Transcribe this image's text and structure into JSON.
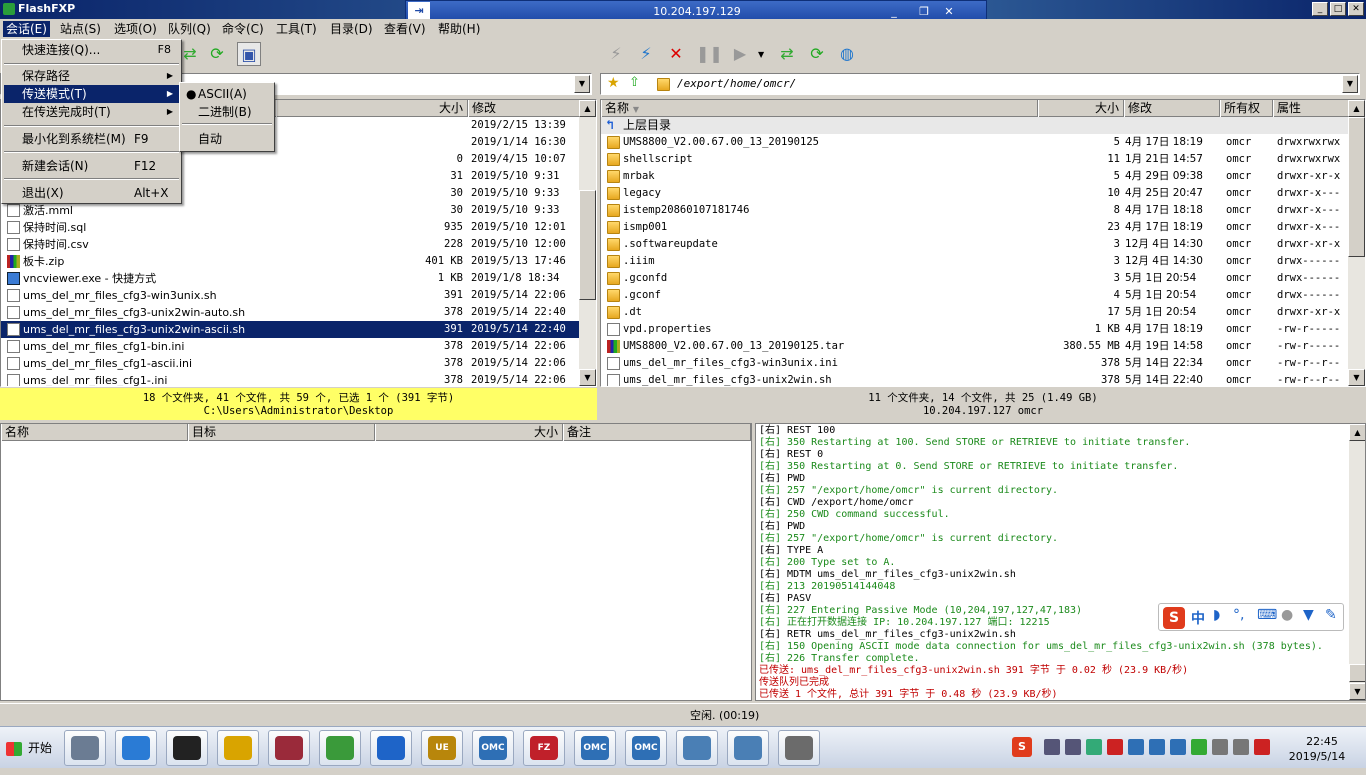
{
  "app": {
    "title": "FlashFXP"
  },
  "remote_session": {
    "title": "10.204.197.129"
  },
  "menubar": [
    "会话(E)",
    "站点(S)",
    "选项(O)",
    "队列(Q)",
    "命令(C)",
    "工具(T)",
    "目录(D)",
    "查看(V)",
    "帮助(H)"
  ],
  "session_menu": {
    "items": [
      {
        "label": "快速连接(Q)...",
        "shortcut": "F8"
      },
      {
        "label": "保存路径",
        "shortcut": ""
      },
      {
        "label": "传送模式(T)",
        "shortcut": ""
      },
      {
        "label": "在传送完成时(T)",
        "shortcut": ""
      },
      {
        "label": "最小化到系统栏(M)",
        "shortcut": "F9"
      },
      {
        "label": "新建会话(N)",
        "shortcut": "F12"
      },
      {
        "label": "退出(X)",
        "shortcut": "Alt+X"
      }
    ]
  },
  "transfer_submenu": [
    "ASCII(A)",
    "二进制(B)",
    "自动"
  ],
  "left_panel": {
    "path": "",
    "columns": {
      "size": "大小",
      "modified": "修改"
    },
    "rows": [
      {
        "name": "",
        "size": "",
        "date": "2019/2/15 13:39",
        "icon": "folder"
      },
      {
        "name": "",
        "size": "",
        "date": "2019/1/14 16:30",
        "icon": "folder"
      },
      {
        "name": "",
        "size": "0",
        "date": "2019/4/15 10:07",
        "icon": "file"
      },
      {
        "name": "",
        "size": "31",
        "date": "2019/5/10 9:31",
        "icon": "file"
      },
      {
        "name": "",
        "size": "30",
        "date": "2019/5/10 9:33",
        "icon": "file"
      },
      {
        "name": "激活.mml",
        "size": "30",
        "date": "2019/5/10 9:33",
        "icon": "file"
      },
      {
        "name": "保持时间.sql",
        "size": "935",
        "date": "2019/5/10 12:01",
        "icon": "file"
      },
      {
        "name": "保持时间.csv",
        "size": "228",
        "date": "2019/5/10 12:00",
        "icon": "file"
      },
      {
        "name": "板卡.zip",
        "size": "401 KB",
        "date": "2019/5/13 17:46",
        "icon": "zip"
      },
      {
        "name": "vncviewer.exe - 快捷方式",
        "size": "1 KB",
        "date": "2019/1/8 18:34",
        "icon": "app"
      },
      {
        "name": "ums_del_mr_files_cfg3-win3unix.sh",
        "size": "391",
        "date": "2019/5/14 22:06",
        "icon": "file"
      },
      {
        "name": "ums_del_mr_files_cfg3-unix2win-auto.sh",
        "size": "378",
        "date": "2019/5/14 22:40",
        "icon": "file"
      },
      {
        "name": "ums_del_mr_files_cfg3-unix2win-ascii.sh",
        "size": "391",
        "date": "2019/5/14 22:40",
        "icon": "file",
        "selected": true
      },
      {
        "name": "ums_del_mr_files_cfg1-bin.ini",
        "size": "378",
        "date": "2019/5/14 22:06",
        "icon": "file"
      },
      {
        "name": "ums_del_mr_files_cfg1-ascii.ini",
        "size": "378",
        "date": "2019/5/14 22:06",
        "icon": "file"
      },
      {
        "name": "ums_del_mr_files_cfg1-.ini",
        "size": "378",
        "date": "2019/5/14 22:06",
        "icon": "file"
      }
    ],
    "status_line1": "18 个文件夹, 41 个文件, 共 59 个, 已选 1 个 (391 字节)",
    "status_line2": "C:\\Users\\Administrator\\Desktop"
  },
  "right_panel": {
    "path": "/export/home/omcr/",
    "columns": {
      "name": "名称",
      "size": "大小",
      "modified": "修改",
      "owner": "所有权",
      "attr": "属性"
    },
    "parent_label": "上层目录",
    "rows": [
      {
        "name": "UMS8800_V2.00.67.00_13_20190125",
        "size": "5",
        "date": "4月 17日 18:19",
        "owner": "omcr",
        "attr": "drwxrwxrwx",
        "icon": "folder"
      },
      {
        "name": "shellscript",
        "size": "11",
        "date": "1月 21日 14:57",
        "owner": "omcr",
        "attr": "drwxrwxrwx",
        "icon": "folder"
      },
      {
        "name": "mrbak",
        "size": "5",
        "date": "4月 29日 09:38",
        "owner": "omcr",
        "attr": "drwxr-xr-x",
        "icon": "folder"
      },
      {
        "name": "legacy",
        "size": "10",
        "date": "4月 25日 20:47",
        "owner": "omcr",
        "attr": "drwxr-x---",
        "icon": "folder"
      },
      {
        "name": "istemp20860107181746",
        "size": "8",
        "date": "4月 17日 18:18",
        "owner": "omcr",
        "attr": "drwxr-x---",
        "icon": "folder"
      },
      {
        "name": "ismp001",
        "size": "23",
        "date": "4月 17日 18:19",
        "owner": "omcr",
        "attr": "drwxr-x---",
        "icon": "folder"
      },
      {
        "name": ".softwareupdate",
        "size": "3",
        "date": "12月 4日 14:30",
        "owner": "omcr",
        "attr": "drwxr-xr-x",
        "icon": "folder"
      },
      {
        "name": ".iiim",
        "size": "3",
        "date": "12月 4日 14:30",
        "owner": "omcr",
        "attr": "drwx------",
        "icon": "folder"
      },
      {
        "name": ".gconfd",
        "size": "3",
        "date": "5月 1日 20:54",
        "owner": "omcr",
        "attr": "drwx------",
        "icon": "folder"
      },
      {
        "name": ".gconf",
        "size": "4",
        "date": "5月 1日 20:54",
        "owner": "omcr",
        "attr": "drwx------",
        "icon": "folder"
      },
      {
        "name": ".dt",
        "size": "17",
        "date": "5月 1日 20:54",
        "owner": "omcr",
        "attr": "drwxr-xr-x",
        "icon": "folder"
      },
      {
        "name": "vpd.properties",
        "size": "1 KB",
        "date": "4月 17日 18:19",
        "owner": "omcr",
        "attr": "-rw-r-----",
        "icon": "file"
      },
      {
        "name": "UMS8800_V2.00.67.00_13_20190125.tar",
        "size": "380.55 MB",
        "date": "4月 19日 14:58",
        "owner": "omcr",
        "attr": "-rw-r-----",
        "icon": "zip"
      },
      {
        "name": "ums_del_mr_files_cfg3-win3unix.ini",
        "size": "378",
        "date": "5月 14日 22:34",
        "owner": "omcr",
        "attr": "-rw-r--r--",
        "icon": "file"
      },
      {
        "name": "ums_del_mr_files_cfg3-unix2win.sh",
        "size": "378",
        "date": "5月 14日 22:40",
        "owner": "omcr",
        "attr": "-rw-r--r--",
        "icon": "file"
      }
    ],
    "status_line1": "11 个文件夹, 14 个文件, 共 25 (1.49 GB)",
    "status_line2": "10.204.197.127 omcr"
  },
  "queue": {
    "columns": [
      "名称",
      "目标",
      "大小",
      "备注"
    ]
  },
  "log": [
    {
      "t": "[右] REST 100",
      "k": "cmd"
    },
    {
      "t": "[右] 350 Restarting at 100. Send STORE or RETRIEVE to initiate transfer.",
      "k": "resp"
    },
    {
      "t": "[右] REST 0",
      "k": "cmd"
    },
    {
      "t": "[右] 350 Restarting at 0. Send STORE or RETRIEVE to initiate transfer.",
      "k": "resp"
    },
    {
      "t": "[右] PWD",
      "k": "cmd"
    },
    {
      "t": "[右] 257 \"/export/home/omcr\" is current directory.",
      "k": "resp"
    },
    {
      "t": "[右] CWD /export/home/omcr",
      "k": "cmd"
    },
    {
      "t": "[右] 250 CWD command successful.",
      "k": "resp"
    },
    {
      "t": "[右] PWD",
      "k": "cmd"
    },
    {
      "t": "[右] 257 \"/export/home/omcr\" is current directory.",
      "k": "resp"
    },
    {
      "t": "[右] TYPE A",
      "k": "cmd"
    },
    {
      "t": "[右] 200 Type set to A.",
      "k": "resp"
    },
    {
      "t": "[右] MDTM ums_del_mr_files_cfg3-unix2win.sh",
      "k": "cmd"
    },
    {
      "t": "[右] 213 20190514144048",
      "k": "resp"
    },
    {
      "t": "[右] PASV",
      "k": "cmd"
    },
    {
      "t": "[右] 227 Entering Passive Mode (10,204,197,127,47,183)",
      "k": "resp"
    },
    {
      "t": "[右] 正在打开数据连接 IP: 10.204.197.127 端口: 12215",
      "k": "resp"
    },
    {
      "t": "[右] RETR ums_del_mr_files_cfg3-unix2win.sh",
      "k": "cmd"
    },
    {
      "t": "[右] 150 Opening ASCII mode data connection for ums_del_mr_files_cfg3-unix2win.sh (378 bytes).",
      "k": "resp"
    },
    {
      "t": "[右] 226 Transfer complete.",
      "k": "resp"
    },
    {
      "t": "已传送: ums_del_mr_files_cfg3-unix2win.sh 391 字节 于 0.02 秒 (23.9 KB/秒)",
      "k": "red"
    },
    {
      "t": "传送队列已完成",
      "k": "red"
    },
    {
      "t": "已传送 1 个文件, 总计 391 字节 于 0.48 秒 (23.9 KB/秒)",
      "k": "red"
    }
  ],
  "statusbar": {
    "text": "空闲. (00:19)"
  },
  "ime": {
    "label": "中"
  },
  "taskbar": {
    "start": "开始",
    "apps": [
      "",
      "",
      "",
      "",
      "",
      "",
      "",
      "UE",
      "OMC",
      "FZ",
      "OMC",
      "OMC",
      "",
      "",
      ""
    ],
    "clock_time": "22:45",
    "clock_date": "2019/5/14"
  }
}
